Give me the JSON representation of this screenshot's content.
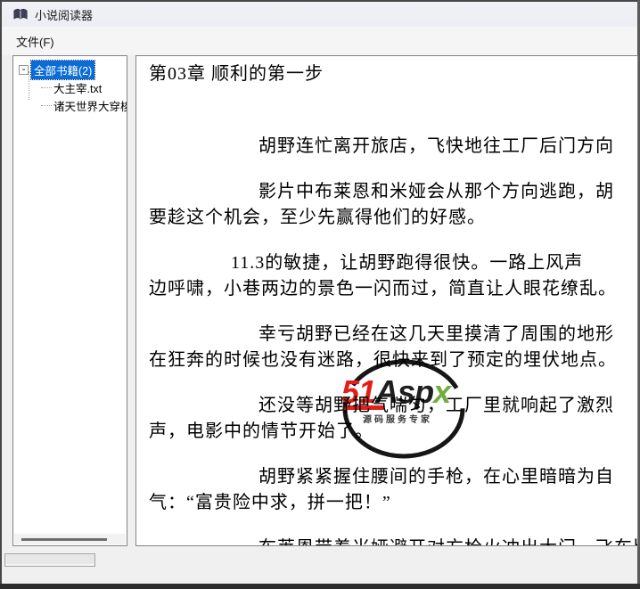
{
  "window": {
    "title": "小说阅读器"
  },
  "menubar": {
    "items": [
      {
        "label": "文件(F)"
      }
    ]
  },
  "tree": {
    "root_label": "全部书籍(2)",
    "expand_glyph": "-",
    "children": [
      "大主宰.txt",
      "诸天世界大穿梭.t"
    ]
  },
  "reader": {
    "lines": [
      {
        "text": "第03章 顺利的第一步",
        "type": "title"
      },
      {
        "text": "胡野连忙离开旅店，飞快地往工厂后门方向",
        "type": "first"
      },
      {
        "text": "影片中布莱恩和米娅会从那个方向逃跑，胡",
        "type": "first"
      },
      {
        "text": "要趁这个机会，至少先赢得他们的好感。",
        "type": "cont"
      },
      {
        "text": "11.3的敏捷，让胡野跑得很快。一路上风声",
        "type": "first-sm"
      },
      {
        "text": "边呼啸，小巷两边的景色一闪而过，简直让人眼花缭乱。",
        "type": "cont"
      },
      {
        "text": "幸亏胡野已经在这几天里摸清了周围的地形",
        "type": "first"
      },
      {
        "text": "在狂奔的时候也没有迷路，很快来到了预定的埋伏地点。",
        "type": "cont"
      },
      {
        "text": "还没等胡野把气喘匀，工厂里就响起了激烈",
        "type": "first"
      },
      {
        "text": "声，电影中的情节开始了。",
        "type": "cont"
      },
      {
        "text": "胡野紧紧握住腰间的手枪，在心里暗暗为自",
        "type": "first"
      },
      {
        "text": "气：“富贵险中求，拼一把！”",
        "type": "cont"
      },
      {
        "text": "布莱恩带着米娅避开对方枪火冲出大门，飞车比赛",
        "type": "first"
      }
    ]
  },
  "watermark": {
    "brand_51": "51",
    "brand_rest": "Asp",
    "brand_x": "x",
    "tagline": "源码服务专家",
    "colors": {
      "red": "#e31e18",
      "dark": "#1f1f1f",
      "green": "#6fae3c"
    }
  }
}
